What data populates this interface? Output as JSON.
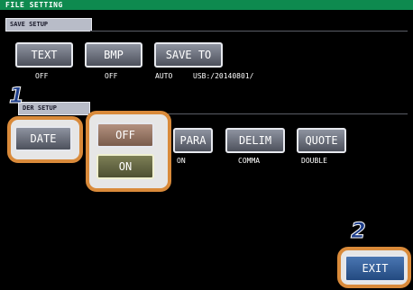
{
  "window": {
    "title": "FILE SETTING"
  },
  "save_setup": {
    "label": "SAVE SETUP",
    "text_button": "TEXT",
    "text_value": "OFF",
    "bmp_button": "BMP",
    "bmp_value": "OFF",
    "save_to_button": "SAVE TO",
    "save_to_mode": "AUTO",
    "save_to_path": "USB:/20140801/"
  },
  "text_setup": {
    "label": "DER SETUP",
    "date_button": "DATE",
    "date_options": [
      "OFF",
      "ON"
    ],
    "para_button": "PARA",
    "para_value": "ON",
    "delim_button": "DELIM",
    "delim_value": "COMMA",
    "quote_button": "QUOTE",
    "quote_value": "DOUBLE"
  },
  "exit_button": "EXIT",
  "steps": {
    "one": "1",
    "two": "2"
  },
  "colors": {
    "accent_ring": "#d98a3a",
    "title_bar": "#0e8a4f",
    "step_number": "#1d3d8a",
    "exit_button": "#2f5e9c"
  }
}
